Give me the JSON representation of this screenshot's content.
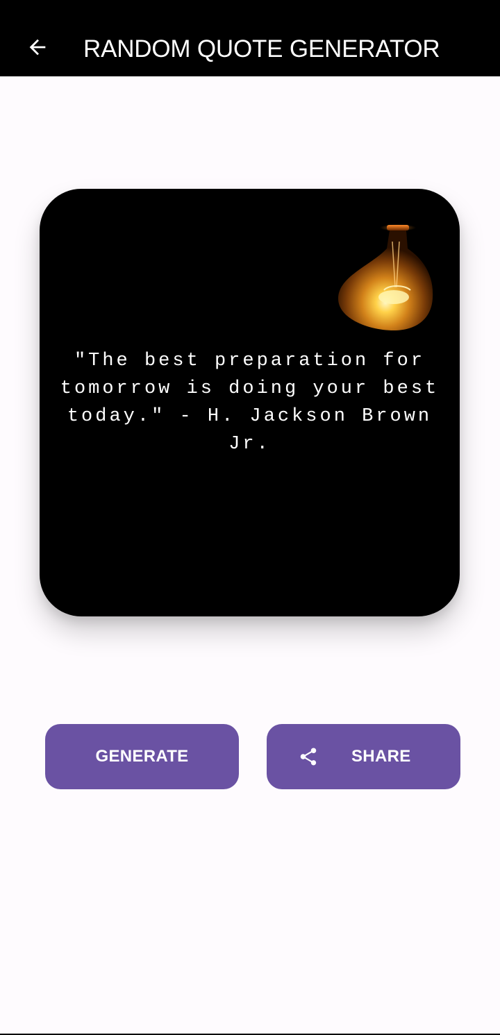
{
  "app_bar": {
    "title": "RANDOM QUOTE GENERATOR",
    "back_icon": "arrow-back-icon"
  },
  "quote_card": {
    "quote": "\"The best preparation for tomorrow is doing your best today.\" - H. Jackson Brown Jr.",
    "image_icon": "light-bulb-icon"
  },
  "actions": {
    "generate_label": "GENERATE",
    "share_label": "SHARE",
    "share_icon": "share-icon"
  },
  "colors": {
    "app_bar_bg": "#000000",
    "page_bg": "#fefbfe",
    "card_bg": "#000000",
    "button_bg": "#6a52a3",
    "button_text": "#ffffff"
  }
}
